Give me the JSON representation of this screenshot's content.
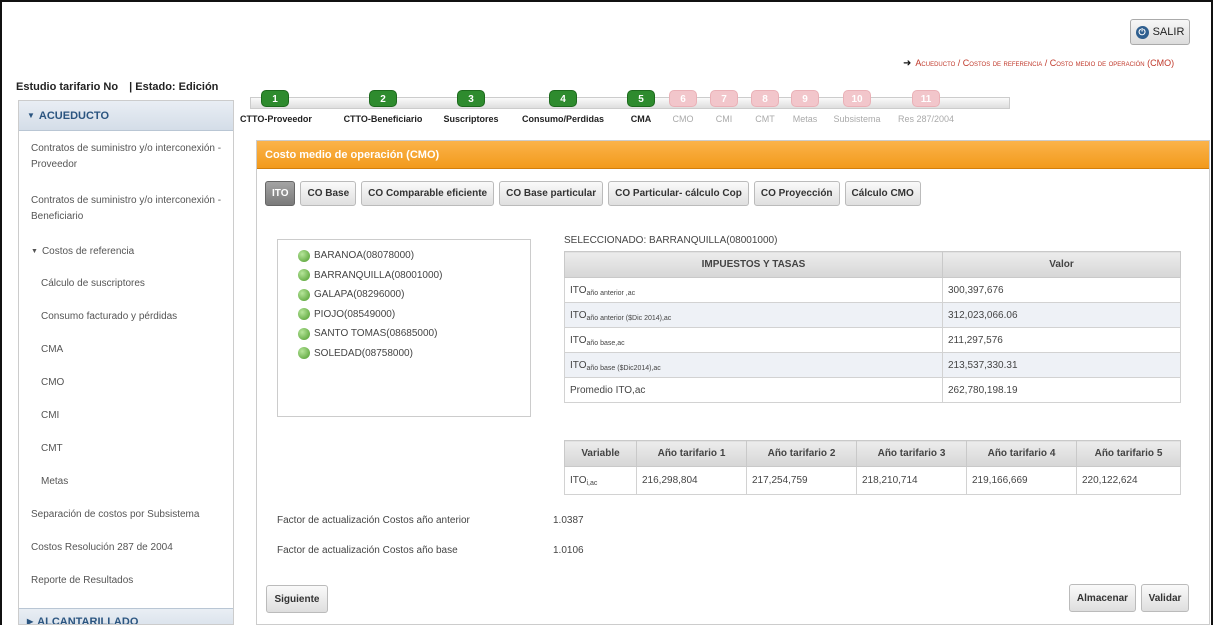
{
  "header": {
    "exit_label": "SALIR",
    "exit_icon": "power-icon",
    "breadcrumb": "Acueducto / Costos de referencia / Costo medio de operación (CMO)",
    "study_label": "Estudio tarifario No",
    "state_label": "| Estado: Edición"
  },
  "sidebar": {
    "section": "ACUEDUCTO",
    "items": [
      "Contratos de suministro y/o interconexión - Proveedor",
      "Contratos de suministro y/o interconexión - Beneficiario",
      "Costos de referencia",
      "Cálculo de suscriptores",
      "Consumo facturado y pérdidas",
      "CMA",
      "CMO",
      "CMI",
      "CMT",
      "Metas",
      "Separación de costos por Subsistema",
      "Costos Resolución 287 de 2004",
      "Reporte de Resultados"
    ],
    "footer_section": "ALCANTARILLADO"
  },
  "steps": [
    {
      "num": "1",
      "label": "CTTO-Proveedor",
      "state": "done"
    },
    {
      "num": "2",
      "label": "CTTO-Beneficiario",
      "state": "done"
    },
    {
      "num": "3",
      "label": "Suscriptores",
      "state": "done"
    },
    {
      "num": "4",
      "label": "Consumo/Perdidas",
      "state": "done"
    },
    {
      "num": "5",
      "label": "CMA",
      "state": "done"
    },
    {
      "num": "6",
      "label": "CMO",
      "state": "disabled"
    },
    {
      "num": "7",
      "label": "CMI",
      "state": "disabled"
    },
    {
      "num": "8",
      "label": "CMT",
      "state": "disabled"
    },
    {
      "num": "9",
      "label": "Metas",
      "state": "disabled"
    },
    {
      "num": "10",
      "label": "Subsistema",
      "state": "disabled"
    },
    {
      "num": "11",
      "label": "Res 287/2004",
      "state": "disabled"
    }
  ],
  "panel": {
    "title": "Costo medio de operación (CMO)",
    "tabs": [
      "ITO",
      "CO Base",
      "CO Comparable eficiente",
      "CO Base particular",
      "CO Particular- cálculo Cop",
      "CO Proyección",
      "Cálculo CMO"
    ],
    "municipalities": [
      "BARANOA(08078000)",
      "BARRANQUILLA(08001000)",
      "GALAPA(08296000)",
      "PIOJO(08549000)",
      "SANTO TOMAS(08685000)",
      "SOLEDAD(08758000)"
    ],
    "selected": "SELECCIONADO: BARRANQUILLA(08001000)",
    "taxes": {
      "header_name": "IMPUESTOS Y TASAS",
      "header_value": "Valor",
      "rows": [
        {
          "base": "ITO",
          "sub": "año anterior ,ac",
          "value": "300,397,676"
        },
        {
          "base": "ITO",
          "sub": "año anterior ($Dic 2014),ac",
          "value": "312,023,066.06"
        },
        {
          "base": "ITO",
          "sub": "año base,ac",
          "value": "211,297,576"
        },
        {
          "base": "ITO",
          "sub": "año base ($Dic2014),ac",
          "value": "213,537,330.31"
        },
        {
          "base": "Promedio ITO,ac",
          "sub": "",
          "value": "262,780,198.19"
        }
      ]
    },
    "years": {
      "headers": [
        "Variable",
        "Año tarifario 1",
        "Año tarifario 2",
        "Año tarifario 3",
        "Año tarifario 4",
        "Año tarifario 5"
      ],
      "row": {
        "base": "ITO",
        "sub": "i,ac",
        "values": [
          "216,298,804",
          "217,254,759",
          "218,210,714",
          "219,166,669",
          "220,122,624"
        ]
      }
    },
    "factors": [
      {
        "label": "Factor de actualización Costos año anterior",
        "value": "1.0387"
      },
      {
        "label": "Factor de actualización Costos año base",
        "value": "1.0106"
      }
    ],
    "buttons": {
      "next": "Siguiente",
      "store": "Almacenar",
      "validate": "Validar"
    }
  }
}
